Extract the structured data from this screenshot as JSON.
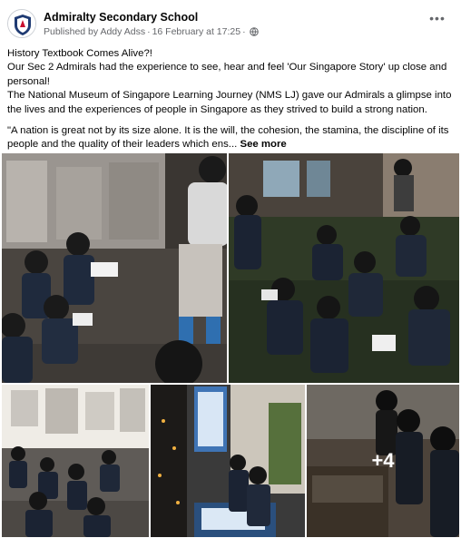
{
  "post": {
    "page_name": "Admiralty Secondary School",
    "published_by": "Published by Addy Adss",
    "date": "16 February at 17:25",
    "more_icon": "ellipsis-icon",
    "privacy_icon": "globe-icon"
  },
  "message": {
    "line1": "History Textbook Comes Alive?!",
    "line2": "Our Sec 2 Admirals had the experience to see, hear and feel 'Our Singapore Story' up close and personal!",
    "line3": "The National Museum of Singapore Learning Journey (NMS LJ) gave our Admirals a glimpse into the lives and the experiences of people in Singapore as they strived to build a strong nation.",
    "quote": "\"A nation is great not by its size alone. It is the will, the cohesion, the stamina, the discipline of its people and the quality of their leaders which ens...",
    "see_more": "See more"
  },
  "gallery": {
    "extra_count": "+4"
  }
}
